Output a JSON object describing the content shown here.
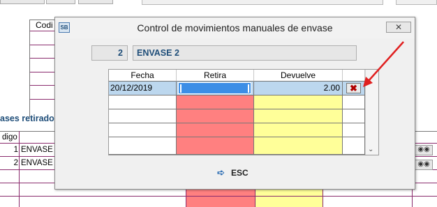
{
  "background": {
    "top_grid_header": "Codi",
    "section_title": "ases retirados",
    "grid_header": "digo",
    "rows": [
      {
        "num": "1",
        "name": "ENVASE"
      },
      {
        "num": "2",
        "name": "ENVASE"
      }
    ]
  },
  "dialog": {
    "app_icon": "SB",
    "title": "Control de movimientos manuales de envase",
    "close_icon": "close-icon",
    "code": "2",
    "name": "ENVASE 2",
    "columns": [
      "Fecha",
      "Retira",
      "Devuelve"
    ],
    "rows": [
      {
        "fecha": "20/12/2019",
        "retira": "",
        "devuelve": "2.00",
        "delete_icon": "delete-x-icon"
      }
    ],
    "esc_label": "ESC",
    "esc_icon": "exit-door-icon"
  },
  "colors": {
    "accent_text": "#1f4e79",
    "retira_fill": "#ff8080",
    "devuelve_fill": "#ffff99",
    "selected_row": "#bcd7ee",
    "editor": "#3c8ee6",
    "annotation_arrow": "#e02020"
  }
}
